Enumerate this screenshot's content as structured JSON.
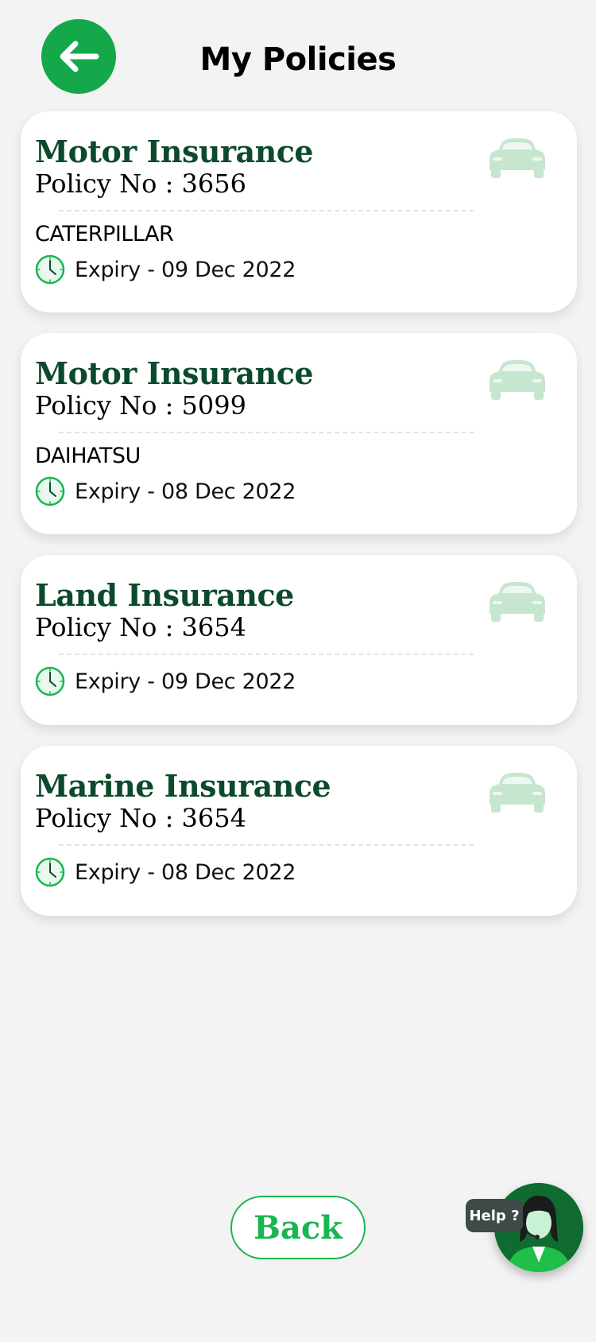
{
  "header": {
    "title": "My Policies",
    "back_icon": "arrow-left-icon"
  },
  "policies": [
    {
      "title": "Motor Insurance",
      "policy_line": "Policy No : 3656",
      "vehicle": "CATERPILLAR",
      "expiry": "Expiry - 09 Dec 2022"
    },
    {
      "title": "Motor Insurance",
      "policy_line": "Policy No : 5099",
      "vehicle": "DAIHATSU",
      "expiry": "Expiry - 08 Dec 2022"
    },
    {
      "title": "Land Insurance",
      "policy_line": "Policy No : 3654",
      "expiry": "Expiry - 09 Dec 2022"
    },
    {
      "title": "Marine Insurance",
      "policy_line": "Policy No : 3654",
      "expiry": "Expiry - 08 Dec 2022"
    }
  ],
  "footer": {
    "back_label": "Back",
    "help_label": "Help ?"
  },
  "colors": {
    "brand_green": "#14a84a",
    "title_green": "#0b4a2a",
    "car_icon": "#c6e6cf"
  },
  "icons": {
    "card_icon": "car-icon",
    "expiry_icon": "clock-icon",
    "help_icon": "support-agent-icon"
  }
}
